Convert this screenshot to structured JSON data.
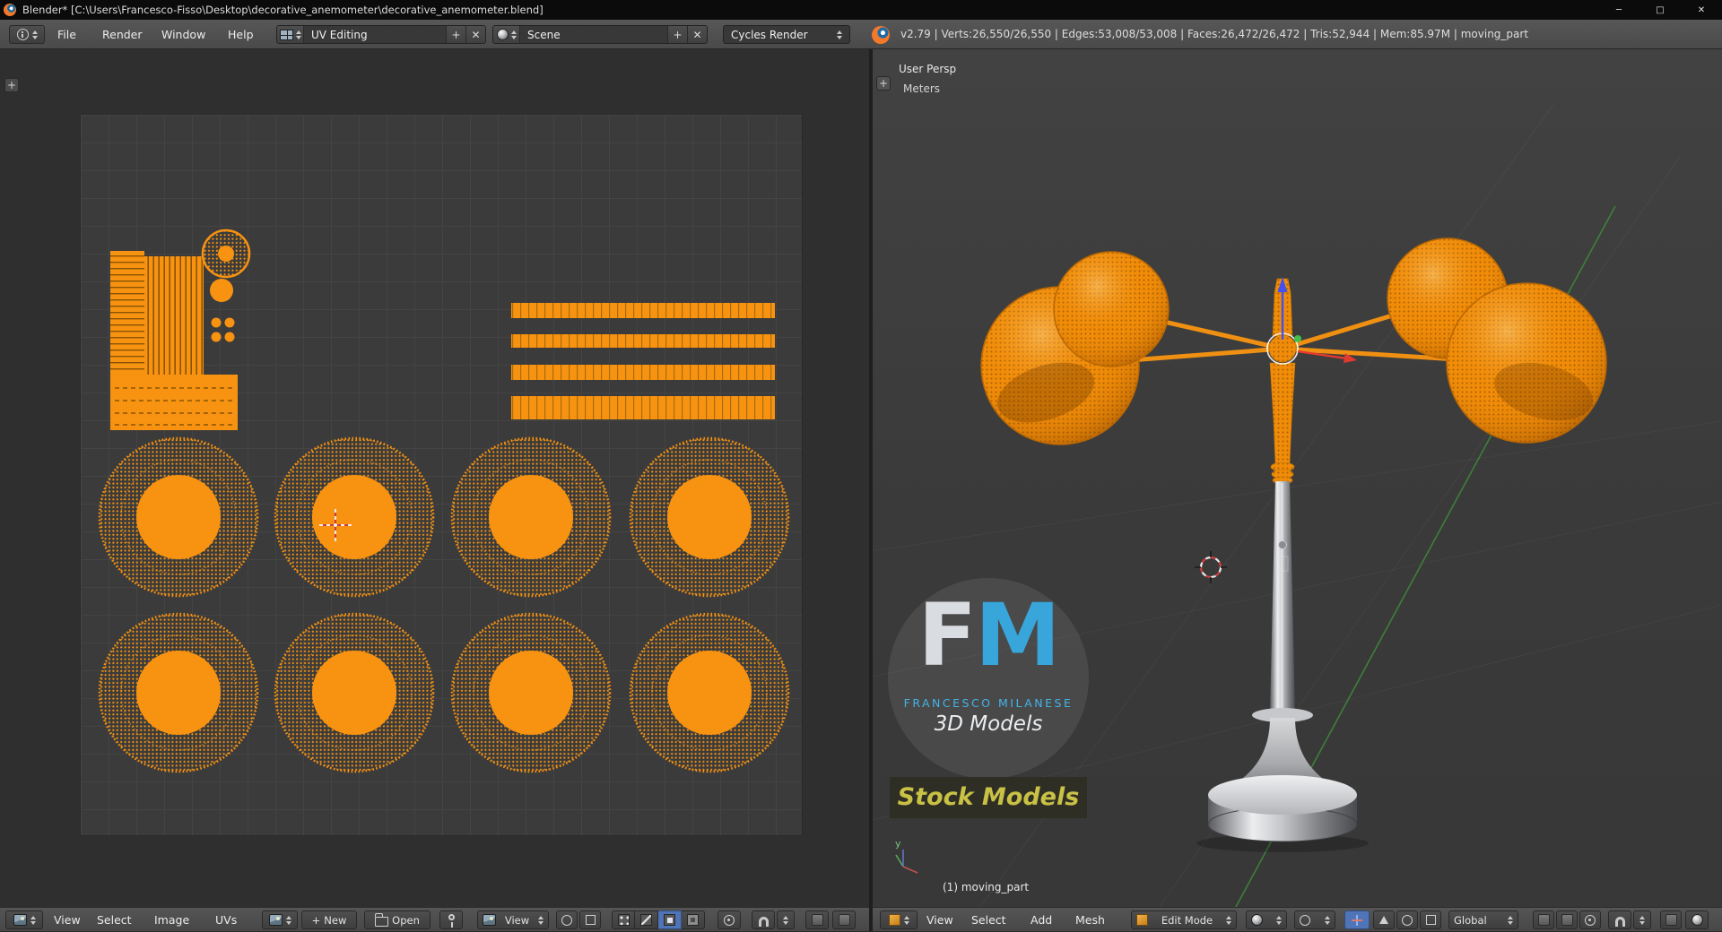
{
  "window": {
    "title": "Blender* [C:\\Users\\Francesco-Fisso\\Desktop\\decorative_anemometer\\decorative_anemometer.blend]",
    "minimize": "─",
    "maximize": "□",
    "close": "✕"
  },
  "glyphs": {
    "plus": "+",
    "close": "✕"
  },
  "info_header": {
    "menus": [
      "File",
      "Render",
      "Window",
      "Help"
    ],
    "layout": "UV Editing",
    "scene": "Scene",
    "engine": "Cycles Render",
    "stats": "v2.79 | Verts:26,550/26,550 | Edges:53,008/53,008 | Faces:26,472/26,472 | Tris:52,944 | Mem:85.97M | moving_part"
  },
  "uv_header": {
    "menus": [
      "View",
      "Select",
      "Image",
      "UVs"
    ],
    "new_label": "New",
    "open_label": "Open",
    "display_mode": "View"
  },
  "v3d": {
    "view_label": "User Persp",
    "units": "Meters",
    "object_info": "(1) moving_part",
    "axis_y": "y"
  },
  "v3d_header": {
    "menus": [
      "View",
      "Select",
      "Add",
      "Mesh"
    ],
    "mode": "Edit Mode",
    "orientation": "Global"
  },
  "watermark": {
    "f": "F",
    "m": "M",
    "name": "FRANCESCO MILANESE",
    "tagline": "3D Models",
    "badge": "Stock Models"
  },
  "colors": {
    "orange": "#f89311",
    "cyan": "#3fa8da",
    "badge_text": "#c9c145"
  }
}
